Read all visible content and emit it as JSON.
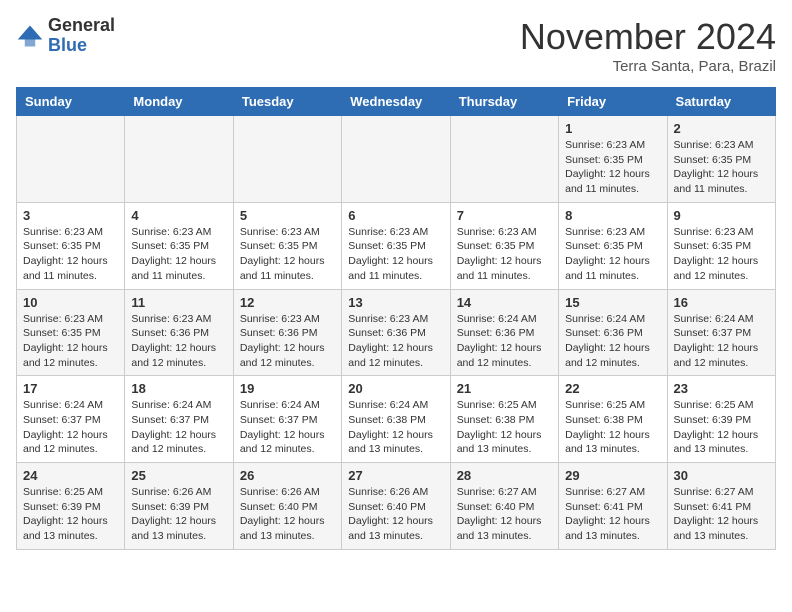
{
  "header": {
    "logo_line1": "General",
    "logo_line2": "Blue",
    "month": "November 2024",
    "location": "Terra Santa, Para, Brazil"
  },
  "weekdays": [
    "Sunday",
    "Monday",
    "Tuesday",
    "Wednesday",
    "Thursday",
    "Friday",
    "Saturday"
  ],
  "weeks": [
    [
      {
        "day": "",
        "info": ""
      },
      {
        "day": "",
        "info": ""
      },
      {
        "day": "",
        "info": ""
      },
      {
        "day": "",
        "info": ""
      },
      {
        "day": "",
        "info": ""
      },
      {
        "day": "1",
        "info": "Sunrise: 6:23 AM\nSunset: 6:35 PM\nDaylight: 12 hours and 11 minutes."
      },
      {
        "day": "2",
        "info": "Sunrise: 6:23 AM\nSunset: 6:35 PM\nDaylight: 12 hours and 11 minutes."
      }
    ],
    [
      {
        "day": "3",
        "info": "Sunrise: 6:23 AM\nSunset: 6:35 PM\nDaylight: 12 hours and 11 minutes."
      },
      {
        "day": "4",
        "info": "Sunrise: 6:23 AM\nSunset: 6:35 PM\nDaylight: 12 hours and 11 minutes."
      },
      {
        "day": "5",
        "info": "Sunrise: 6:23 AM\nSunset: 6:35 PM\nDaylight: 12 hours and 11 minutes."
      },
      {
        "day": "6",
        "info": "Sunrise: 6:23 AM\nSunset: 6:35 PM\nDaylight: 12 hours and 11 minutes."
      },
      {
        "day": "7",
        "info": "Sunrise: 6:23 AM\nSunset: 6:35 PM\nDaylight: 12 hours and 11 minutes."
      },
      {
        "day": "8",
        "info": "Sunrise: 6:23 AM\nSunset: 6:35 PM\nDaylight: 12 hours and 11 minutes."
      },
      {
        "day": "9",
        "info": "Sunrise: 6:23 AM\nSunset: 6:35 PM\nDaylight: 12 hours and 12 minutes."
      }
    ],
    [
      {
        "day": "10",
        "info": "Sunrise: 6:23 AM\nSunset: 6:35 PM\nDaylight: 12 hours and 12 minutes."
      },
      {
        "day": "11",
        "info": "Sunrise: 6:23 AM\nSunset: 6:36 PM\nDaylight: 12 hours and 12 minutes."
      },
      {
        "day": "12",
        "info": "Sunrise: 6:23 AM\nSunset: 6:36 PM\nDaylight: 12 hours and 12 minutes."
      },
      {
        "day": "13",
        "info": "Sunrise: 6:23 AM\nSunset: 6:36 PM\nDaylight: 12 hours and 12 minutes."
      },
      {
        "day": "14",
        "info": "Sunrise: 6:24 AM\nSunset: 6:36 PM\nDaylight: 12 hours and 12 minutes."
      },
      {
        "day": "15",
        "info": "Sunrise: 6:24 AM\nSunset: 6:36 PM\nDaylight: 12 hours and 12 minutes."
      },
      {
        "day": "16",
        "info": "Sunrise: 6:24 AM\nSunset: 6:37 PM\nDaylight: 12 hours and 12 minutes."
      }
    ],
    [
      {
        "day": "17",
        "info": "Sunrise: 6:24 AM\nSunset: 6:37 PM\nDaylight: 12 hours and 12 minutes."
      },
      {
        "day": "18",
        "info": "Sunrise: 6:24 AM\nSunset: 6:37 PM\nDaylight: 12 hours and 12 minutes."
      },
      {
        "day": "19",
        "info": "Sunrise: 6:24 AM\nSunset: 6:37 PM\nDaylight: 12 hours and 12 minutes."
      },
      {
        "day": "20",
        "info": "Sunrise: 6:24 AM\nSunset: 6:38 PM\nDaylight: 12 hours and 13 minutes."
      },
      {
        "day": "21",
        "info": "Sunrise: 6:25 AM\nSunset: 6:38 PM\nDaylight: 12 hours and 13 minutes."
      },
      {
        "day": "22",
        "info": "Sunrise: 6:25 AM\nSunset: 6:38 PM\nDaylight: 12 hours and 13 minutes."
      },
      {
        "day": "23",
        "info": "Sunrise: 6:25 AM\nSunset: 6:39 PM\nDaylight: 12 hours and 13 minutes."
      }
    ],
    [
      {
        "day": "24",
        "info": "Sunrise: 6:25 AM\nSunset: 6:39 PM\nDaylight: 12 hours and 13 minutes."
      },
      {
        "day": "25",
        "info": "Sunrise: 6:26 AM\nSunset: 6:39 PM\nDaylight: 12 hours and 13 minutes."
      },
      {
        "day": "26",
        "info": "Sunrise: 6:26 AM\nSunset: 6:40 PM\nDaylight: 12 hours and 13 minutes."
      },
      {
        "day": "27",
        "info": "Sunrise: 6:26 AM\nSunset: 6:40 PM\nDaylight: 12 hours and 13 minutes."
      },
      {
        "day": "28",
        "info": "Sunrise: 6:27 AM\nSunset: 6:40 PM\nDaylight: 12 hours and 13 minutes."
      },
      {
        "day": "29",
        "info": "Sunrise: 6:27 AM\nSunset: 6:41 PM\nDaylight: 12 hours and 13 minutes."
      },
      {
        "day": "30",
        "info": "Sunrise: 6:27 AM\nSunset: 6:41 PM\nDaylight: 12 hours and 13 minutes."
      }
    ]
  ]
}
